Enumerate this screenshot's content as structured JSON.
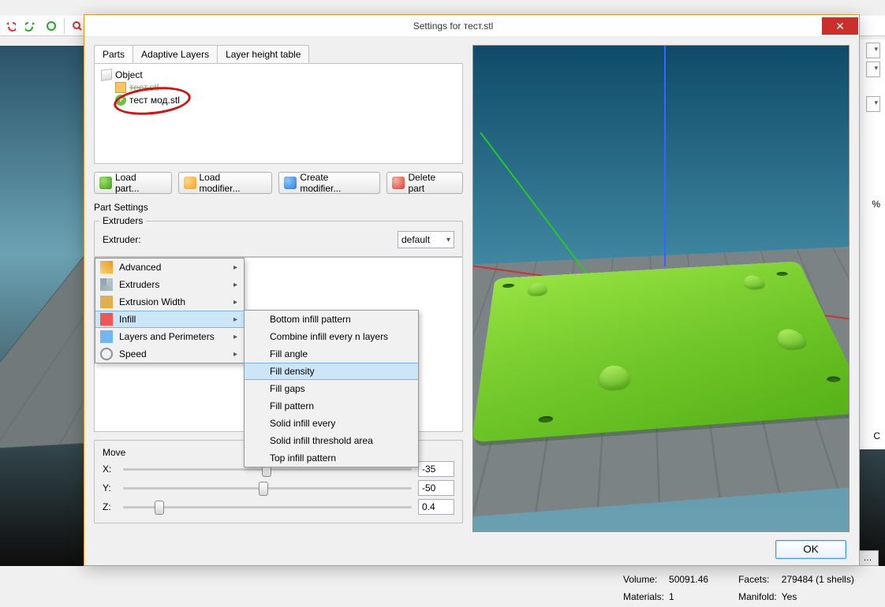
{
  "toolbar": {
    "pct": "%",
    "degC": "C"
  },
  "info": {
    "volume_label": "Volume:",
    "volume": "50091.46",
    "facets_label": "Facets:",
    "facets": "279484 (1 shells)",
    "materials_label": "Materials:",
    "materials": "1",
    "manifold_label": "Manifold:",
    "manifold": "Yes",
    "more": "…"
  },
  "dialog": {
    "title": "Settings for тест.stl",
    "tabs": {
      "parts": "Parts",
      "adaptive": "Adaptive Layers",
      "table": "Layer height table"
    },
    "tree": {
      "root": "Object",
      "file1": "тест.stl",
      "file2": "тест мод.stl"
    },
    "buttons": {
      "load": "Load part...",
      "loadmod": "Load modifier...",
      "createmod": "Create modifier...",
      "delete": "Delete part"
    },
    "part_settings": "Part Settings",
    "extruders_legend": "Extruders",
    "extruder_label": "Extruder:",
    "extruder_value": "default",
    "menu": {
      "advanced": "Advanced",
      "extruders": "Extruders",
      "extrusion_width": "Extrusion Width",
      "infill": "Infill",
      "layers": "Layers and Perimeters",
      "speed": "Speed"
    },
    "submenu": {
      "bottom": "Bottom infill pattern",
      "combine": "Combine infill every n layers",
      "angle": "Fill angle",
      "density": "Fill density",
      "gaps": "Fill gaps",
      "pattern": "Fill pattern",
      "solid": "Solid infill every",
      "threshold": "Solid infill threshold area",
      "top": "Top infill pattern"
    },
    "move": {
      "legend": "Move",
      "x_label": "X:",
      "x_value": "-35",
      "y_label": "Y:",
      "y_value": "-50",
      "z_label": "Z:",
      "z_value": "0.4"
    },
    "ok": "OK"
  }
}
